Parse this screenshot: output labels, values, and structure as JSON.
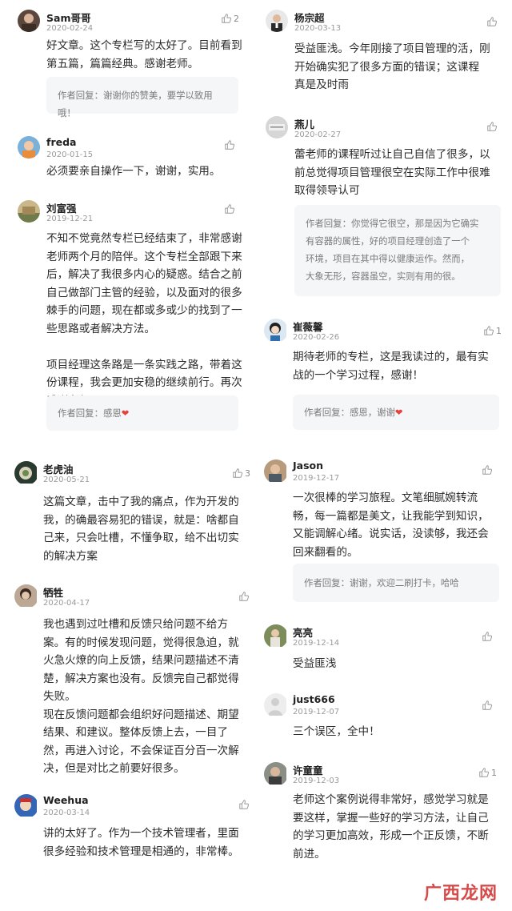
{
  "left": [
    {
      "name": "Sam哥哥",
      "date": "2020-02-24",
      "likes": "2",
      "text": "好文章。这个专栏写的太好了。目前看到\n第五篇，篇篇经典。感谢老师。",
      "reply": "作者回复：谢谢你的赞美，要学以致用哦！",
      "reply_heart": false
    },
    {
      "name": "freda",
      "date": "2020-01-15",
      "likes": "",
      "text": "必须要亲自操作一下，谢谢，实用。",
      "reply": "",
      "reply_heart": false
    },
    {
      "name": "刘富强",
      "date": "2019-12-21",
      "likes": "",
      "text": "不知不觉竟然专栏已经结束了，非常感谢\n老师两个月的陪伴。这个专栏全部跟下来\n后，解决了我很多内心的疑惑。结合之前\n自己做部门主管的经验，以及面对的很多\n棘手的问题，现在都或多或少的找到了一\n些思路或者解决方法。\n\n项目经理这条路是一条实践之路，带着这\n份课程，我会更加安稳的继续前行。再次\n感谢老师。",
      "reply": "作者回复：感恩",
      "reply_heart": true
    },
    {
      "name": "老虎油",
      "date": "2020-05-21",
      "likes": "3",
      "text": "这篇文章，击中了我的痛点，作为开发的\n我，的确最容易犯的错误，就是：啥都自\n己来，只会吐槽，不懂争取，给不出切实\n的解决方案",
      "reply": "",
      "reply_heart": false
    },
    {
      "name": "牺牲",
      "date": "2020-04-17",
      "likes": "",
      "text": "我也遇到过吐槽和反馈只给问题不给方\n案。有的时候发现问题，觉得很急迫，就\n火急火燎的向上反馈，结果问题描述不清\n楚，解决方案也没有。反馈完自己都觉得\n失败。\n现在反馈问题都会组织好问题描述、期望\n结果、和建议。整体反馈上去，一目了\n然，再进入讨论，不会保证百分百一次解\n决，但是对比之前要好很多。",
      "reply": "",
      "reply_heart": false
    },
    {
      "name": "Weehua",
      "date": "2020-03-14",
      "likes": "",
      "text": "讲的太好了。作为一个技术管理者，里面\n很多经验和技术管理是相通的，非常棒。",
      "reply": "",
      "reply_heart": false
    }
  ],
  "right": [
    {
      "name": "杨宗超",
      "date": "2020-03-13",
      "likes": "",
      "text": "受益匪浅。今年刚接了项目管理的活，刚\n开始确实犯了很多方面的错误；这课程\n真是及时雨",
      "reply": "",
      "reply_heart": false
    },
    {
      "name": "燕儿",
      "date": "2020-02-27",
      "likes": "",
      "text": "蕾老师的课程听过让自己自信了很多，以\n前总觉得项目管理很空在实际工作中很难\n取得领导认可",
      "reply": "作者回复：你觉得它很空，那是因为它确实\n有容器的属性，好的项目经理创造了一个\n环境，项目在其中得以健康运作。然而，\n大象无形，容器虽空，实则有用的很。",
      "reply_heart": false
    },
    {
      "name": "崔薇馨",
      "date": "2020-02-26",
      "likes": "1",
      "text": "期待老师的专栏，这是我读过的，最有实\n战的一个学习过程，感谢！",
      "reply": "作者回复：感恩，谢谢",
      "reply_heart": true
    },
    {
      "name": "Jason",
      "date": "2019-12-17",
      "likes": "",
      "text": "一次很棒的学习旅程。文笔细腻婉转流\n畅，每一篇都是美文，让我能学到知识，\n又能调解心绪。说实话，没读够，我还会\n回来翻看的。",
      "reply": "作者回复：谢谢，欢迎二刷打卡，哈哈",
      "reply_heart": false
    },
    {
      "name": "亮亮",
      "date": "2019-12-14",
      "likes": "",
      "text": "受益匪浅",
      "reply": "",
      "reply_heart": false
    },
    {
      "name": "just666",
      "date": "2019-12-07",
      "likes": "",
      "text": "三个误区，全中！",
      "reply": "",
      "reply_heart": false
    },
    {
      "name": "许童童",
      "date": "2019-12-03",
      "likes": "1",
      "text": "老师这个案例说得非常好，感觉学习就是\n要这样，掌握一些好的学习方法，让自己\n的学习更加高效，形成一个正反馈，不断\n前进。",
      "reply": "",
      "reply_heart": false
    }
  ],
  "watermark": "广西龙网",
  "heart_glyph": "❤",
  "colors": {
    "reply_bg": "#f5f6f8",
    "heart": "#e8413b",
    "watermark": "#d12b2b"
  }
}
